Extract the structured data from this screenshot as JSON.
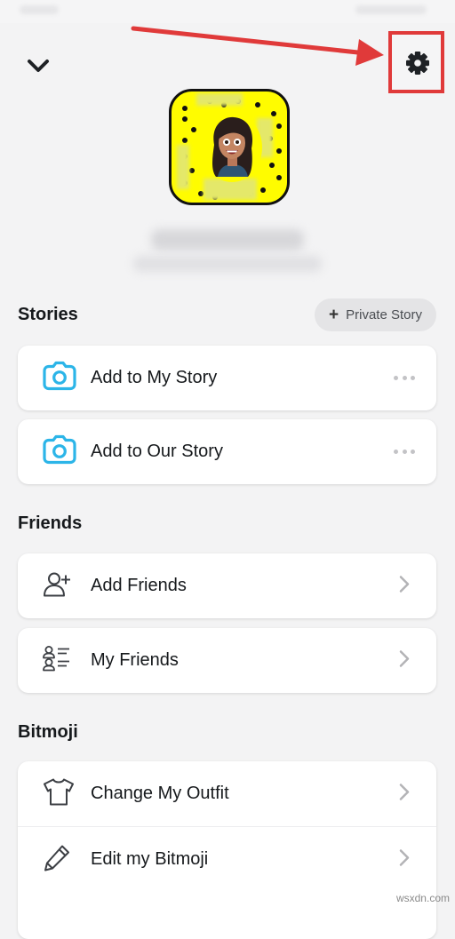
{
  "header": {
    "collapse_icon": "chevron-down-icon",
    "settings_icon": "gear-icon",
    "highlight_color": "#e03a3a"
  },
  "profile": {
    "snapcode_color": "#fffc00"
  },
  "stories": {
    "title": "Stories",
    "private_story_label": "Private Story",
    "items": [
      {
        "label": "Add to My Story",
        "icon": "camera-icon",
        "more_icon": "more-dots-icon"
      },
      {
        "label": "Add to Our Story",
        "icon": "camera-icon",
        "more_icon": "more-dots-icon"
      }
    ]
  },
  "friends": {
    "title": "Friends",
    "items": [
      {
        "label": "Add Friends",
        "icon": "add-friend-icon"
      },
      {
        "label": "My Friends",
        "icon": "friends-list-icon"
      }
    ]
  },
  "bitmoji": {
    "title": "Bitmoji",
    "items": [
      {
        "label": "Change My Outfit",
        "icon": "shirt-icon"
      },
      {
        "label": "Edit my Bitmoji",
        "icon": "pencil-icon"
      }
    ]
  },
  "watermark": "wsxdn.com",
  "colors": {
    "accent_blue": "#2cb5e8",
    "background": "#f3f3f4",
    "card": "#ffffff"
  }
}
